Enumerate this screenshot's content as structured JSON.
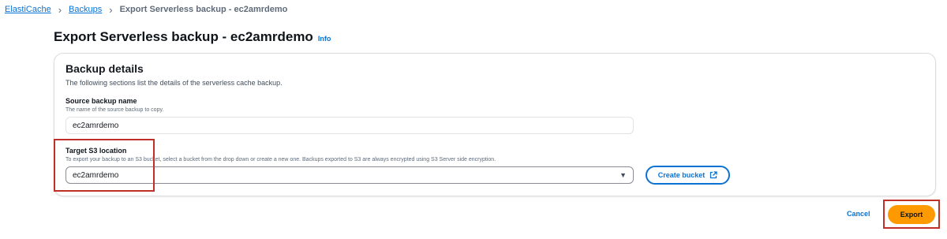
{
  "breadcrumb": {
    "items": [
      "ElastiCache",
      "Backups"
    ],
    "current": "Export Serverless backup - ec2amrdemo"
  },
  "page": {
    "title": "Export Serverless backup - ec2amrdemo",
    "info_link": "Info"
  },
  "backup_details": {
    "title": "Backup details",
    "description": "The following sections list the details of the serverless cache backup.",
    "source": {
      "label": "Source backup name",
      "description": "The name of the source backup to copy.",
      "value": "ec2amrdemo"
    },
    "target": {
      "label": "Target S3 location",
      "description": "To export your backup to an S3 bucket, select a bucket from the drop down or create a new one. Backups exported to S3 are always encrypted using S3 Server side encryption.",
      "value": "ec2amrdemo"
    },
    "create_bucket_label": "Create bucket"
  },
  "actions": {
    "cancel_label": "Cancel",
    "export_label": "Export"
  },
  "colors": {
    "link": "#0972d3",
    "primary": "#ff9900",
    "highlight": "#c0302b"
  }
}
